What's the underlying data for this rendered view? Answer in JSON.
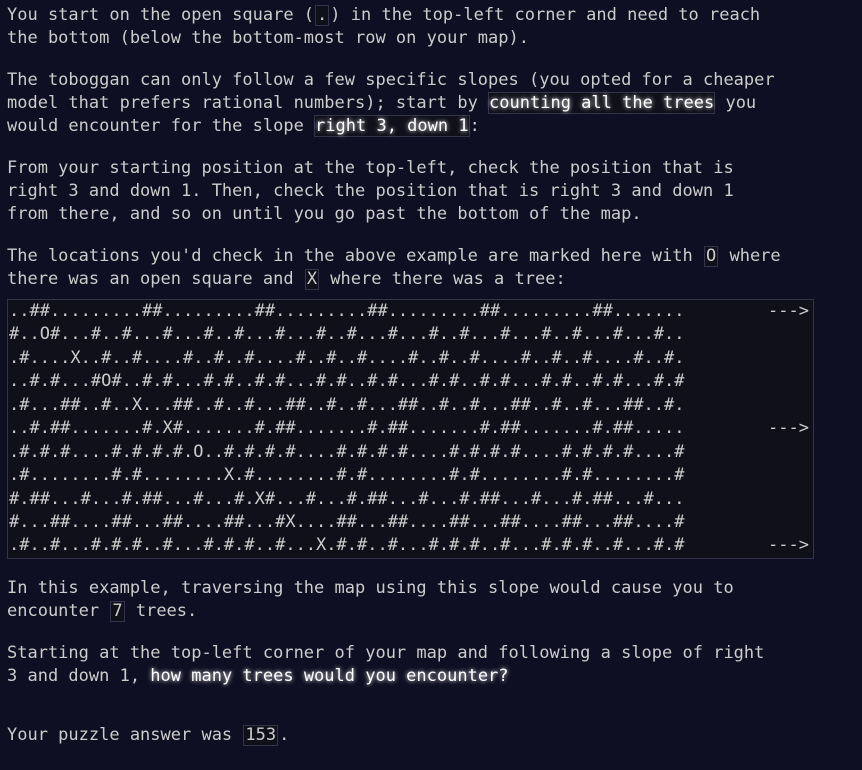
{
  "p1": {
    "line1_a": "You start on the open square (",
    "line1_code": ".",
    "line1_b": ") in the top-left corner and need to reach",
    "line2": "the bottom (below the bottom-most row on your map)."
  },
  "p2": {
    "line1": "The toboggan can only follow a few specific slopes (you opted for a cheaper",
    "line2_a": "model that prefers rational numbers); start by ",
    "line2_em": "counting all the trees",
    "line2_b": " you",
    "line3_a": "would encounter for the slope ",
    "line3_em": "right 3, down 1",
    "line3_b": ":"
  },
  "p3": {
    "line1": "From your starting position at the top-left, check the position that is",
    "line2": "right 3 and down 1. Then, check the position that is right 3 and down 1",
    "line3": "from there, and so on until you go past the bottom of the map."
  },
  "p4": {
    "line1_a": "The locations you'd check in the above example are marked here with ",
    "line1_code": "O",
    "line1_b": " where",
    "line2_a": "there was an open square and ",
    "line2_code": "X",
    "line2_b": " where there was a tree:"
  },
  "map": {
    "rows": [
      "..##.........##.........##.........##.........##.........##.......",
      "#..O#...#..#...#...#..#...#...#..#...#...#..#...#...#..#...#...#..",
      ".#....X..#..#....#..#..#....#..#..#....#..#..#....#..#..#....#..#.",
      "..#.#...#O#..#.#...#.#..#.#...#.#..#.#...#.#..#.#...#.#..#.#...#.#",
      ".#...##..#..X...##..#..#...##..#..#...##..#..#...##..#..#...##..#.",
      "..#.##.......#.X#.......#.##.......#.##.......#.##.......#.##.....",
      ".#.#.#....#.#.#.#.O..#.#.#.#....#.#.#.#....#.#.#.#....#.#.#.#....#",
      ".#........#.#........X.#........#.#........#.#........#.#........#",
      "#.##...#...#.##...#...#.X#...#...#.##...#...#.##...#...#.##...#...",
      "#...##....##...##....##...#X....##...##....##...##....##...##....#",
      ".#..#...#.#.#..#...#.#.#..#...X.#.#..#...#.#.#..#...#.#.#..#...#.#"
    ],
    "arrow": "--->"
  },
  "p5": {
    "line1": "In this example, traversing the map using this slope would cause you to",
    "line2_a": "encounter ",
    "line2_code": "7",
    "line2_b": " trees."
  },
  "p6": {
    "line1": "Starting at the top-left corner of your map and following a slope of right",
    "line2_a": "3 and down 1, ",
    "line2_em": "how many trees would you encounter?"
  },
  "answer": {
    "label": "Your puzzle answer was ",
    "value": "153",
    "suffix": "."
  }
}
